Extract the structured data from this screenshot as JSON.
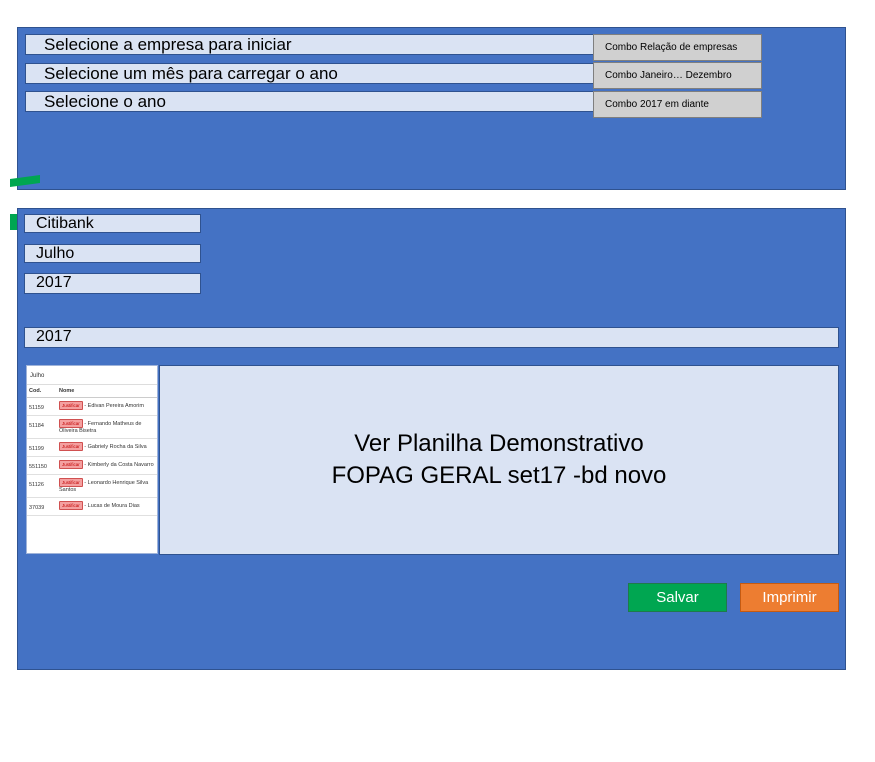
{
  "setup": {
    "rows": [
      {
        "label": "Selecione a empresa para iniciar",
        "note": "Combo Relação de empresas"
      },
      {
        "label": "Selecione um mês para carregar o ano",
        "note": "Combo Janeiro… Dezembro"
      },
      {
        "label": "Selecione o ano",
        "note": "Combo 2017 em diante"
      }
    ]
  },
  "selection": {
    "company": "Citibank",
    "month": "Julho",
    "year": "2017",
    "year_bar": "2017"
  },
  "thumbnail": {
    "month": "Julho",
    "col_cod": "Cod.",
    "col_nome": "Nome",
    "badge": "Justificar",
    "rows": [
      {
        "cod": "51159",
        "nome": "- Edivan Pereira Amorim"
      },
      {
        "cod": "51184",
        "nome": "- Fernando Matheus de Oliveira Bisetra"
      },
      {
        "cod": "51199",
        "nome": "- Gabriely Rocha da Silva"
      },
      {
        "cod": "551150",
        "nome": "- Kimberly da Costa Navarro"
      },
      {
        "cod": "51126",
        "nome": "- Leonardo Henrique Silva Santos"
      },
      {
        "cod": "37039",
        "nome": "- Lucas de Moura Dias"
      }
    ]
  },
  "preview": {
    "line1": "Ver Planilha Demonstrativo",
    "line2": "FOPAG GERAL set17 -bd novo"
  },
  "actions": {
    "save_label": "Salvar",
    "print_label": "Imprimir"
  },
  "colors": {
    "panel": "#4472c4",
    "field": "#dae3f3",
    "save": "#00a651",
    "print": "#ed7d31",
    "arrow": "#00a651"
  }
}
